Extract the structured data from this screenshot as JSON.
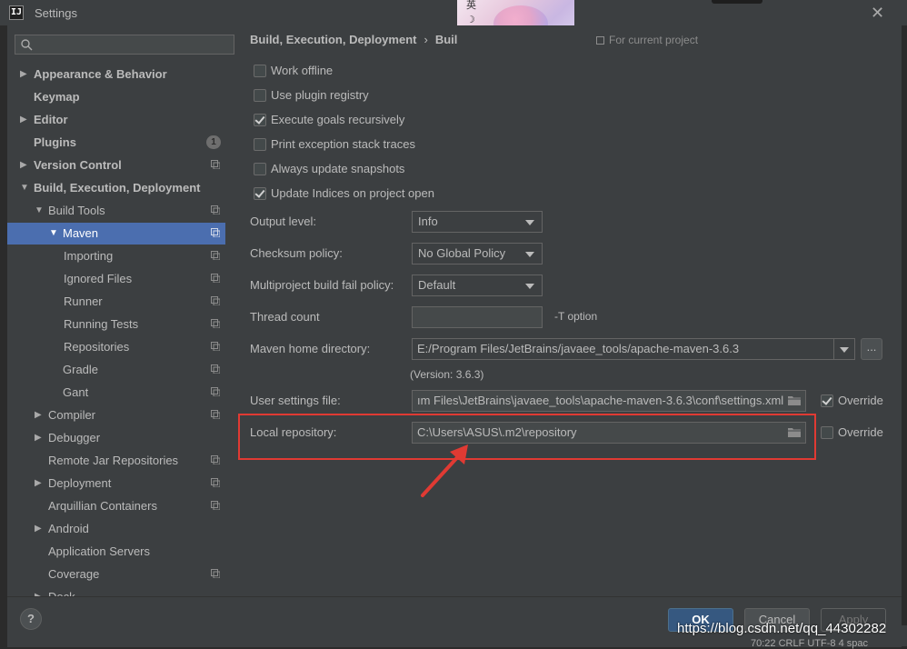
{
  "window": {
    "title": "Settings",
    "app_icon": "IJ"
  },
  "overlay": {
    "text": "英\n☽\n♔"
  },
  "search": {
    "placeholder": ""
  },
  "sidebar": {
    "items": [
      {
        "label": "Appearance & Behavior",
        "arrow": "▶",
        "bold": true,
        "project": false
      },
      {
        "label": "Keymap",
        "arrow": "",
        "bold": true,
        "project": false
      },
      {
        "label": "Editor",
        "arrow": "▶",
        "bold": true,
        "project": false
      },
      {
        "label": "Plugins",
        "arrow": "",
        "bold": true,
        "badge": "1"
      },
      {
        "label": "Version Control",
        "arrow": "▶",
        "bold": true,
        "project": true
      },
      {
        "label": "Build, Execution, Deployment",
        "arrow": "▼",
        "bold": true,
        "project": false
      },
      {
        "label": "Build Tools",
        "arrow": "▼",
        "project": true
      },
      {
        "label": "Maven",
        "arrow": "▼",
        "project": true,
        "selected": true
      },
      {
        "label": "Importing",
        "arrow": "",
        "project": true
      },
      {
        "label": "Ignored Files",
        "arrow": "",
        "project": true
      },
      {
        "label": "Runner",
        "arrow": "",
        "project": true
      },
      {
        "label": "Running Tests",
        "arrow": "",
        "project": true
      },
      {
        "label": "Repositories",
        "arrow": "",
        "project": true
      },
      {
        "label": "Gradle",
        "arrow": "",
        "project": true
      },
      {
        "label": "Gant",
        "arrow": "",
        "project": true
      },
      {
        "label": "Compiler",
        "arrow": "▶",
        "project": true
      },
      {
        "label": "Debugger",
        "arrow": "▶",
        "project": false
      },
      {
        "label": "Remote Jar Repositories",
        "arrow": "",
        "project": true
      },
      {
        "label": "Deployment",
        "arrow": "▶",
        "project": true
      },
      {
        "label": "Arquillian Containers",
        "arrow": "",
        "project": true
      },
      {
        "label": "Android",
        "arrow": "▶",
        "project": false
      },
      {
        "label": "Application Servers",
        "arrow": "",
        "project": false
      },
      {
        "label": "Coverage",
        "arrow": "",
        "project": true
      },
      {
        "label": "Dock",
        "arrow": "▶",
        "project": false
      }
    ]
  },
  "breadcrumb": {
    "part1": "Build, Execution, Deployment",
    "separator": "›",
    "part2": "Buil",
    "for_project": "For current project"
  },
  "checkboxes": [
    {
      "label": "Work offline",
      "checked": false
    },
    {
      "label": "Use plugin registry",
      "checked": false
    },
    {
      "label": "Execute goals recursively",
      "checked": true
    },
    {
      "label": "Print exception stack traces",
      "checked": false
    },
    {
      "label": "Always update snapshots",
      "checked": false
    },
    {
      "label": "Update Indices on project open",
      "checked": true
    }
  ],
  "fields": {
    "output_level": {
      "label": "Output level:",
      "value": "Info"
    },
    "checksum_policy": {
      "label": "Checksum policy:",
      "value": "No Global Policy"
    },
    "fail_policy": {
      "label": "Multiproject build fail policy:",
      "value": "Default"
    },
    "thread_count": {
      "label": "Thread count",
      "value": "",
      "hint": "-T option"
    },
    "maven_home": {
      "label": "Maven home directory:",
      "value": "E:/Program Files/JetBrains/javaee_tools/apache-maven-3.6.3",
      "browse": "...",
      "version": "(Version: 3.6.3)"
    },
    "user_settings": {
      "label": "User settings file:",
      "value": "ım Files\\JetBrains\\javaee_tools\\apache-maven-3.6.3\\conf\\settings.xml",
      "override_label": "Override",
      "override": true
    },
    "local_repo": {
      "label": "Local repository:",
      "value": "C:\\Users\\ASUS\\.m2\\repository",
      "override_label": "Override",
      "override": false
    }
  },
  "buttons": {
    "help": "?",
    "ok": "OK",
    "cancel": "Cancel",
    "apply": "Apply"
  },
  "watermark": "https://blog.csdn.net/qq_44302282",
  "statusbar": "70:22   CRLF   UTF-8   4 spac",
  "colors": {
    "accent": "#4b6eaf",
    "ok_button": "#365880",
    "highlight_box": "#e03a33"
  }
}
